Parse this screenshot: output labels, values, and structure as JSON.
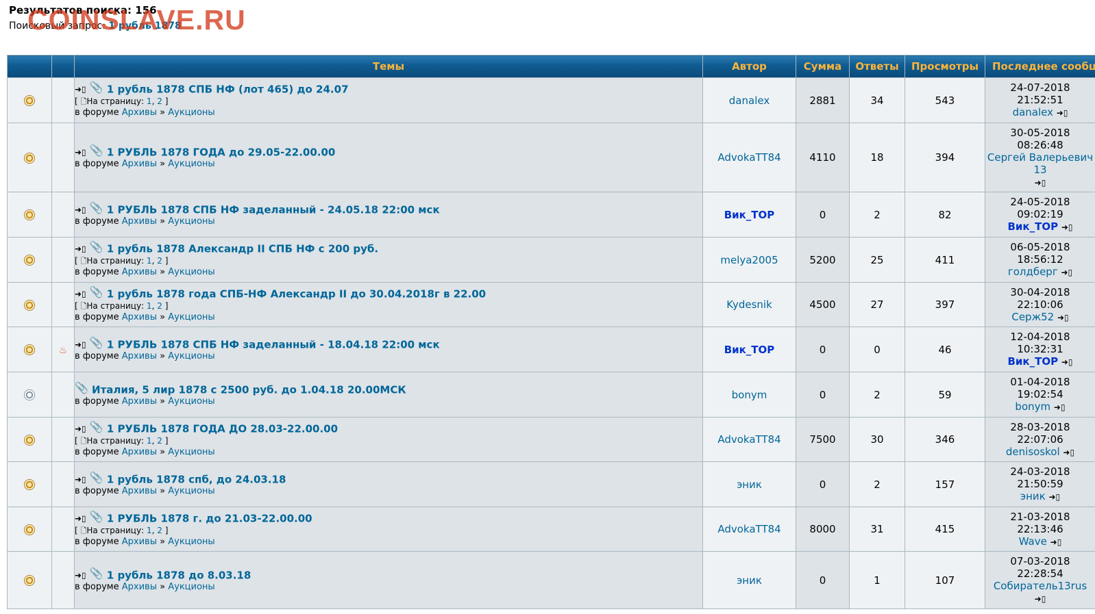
{
  "header": {
    "results_count": "Результатов поиска: 156",
    "query_label": "Поисковый запрос:",
    "query": "1 рубль 1878",
    "watermark": "COINSLAVE.RU"
  },
  "columns": {
    "topics": "Темы",
    "author": "Автор",
    "sum": "Сумма",
    "replies": "Ответы",
    "views": "Просмотры",
    "last_post": "Последнее сообщ"
  },
  "labels": {
    "forum_prefix": "в форуме",
    "sep": "»",
    "pages_open": "[",
    "pages_label": "На страницу:",
    "pages_close": "]",
    "page1": "1",
    "page2": "2",
    "comma": ",",
    "clip": "📎",
    "new_arrow": "➜▯",
    "last_arrow": "➜▯",
    "doc": "🗋",
    "hot": "♨"
  },
  "rows": [
    {
      "title": "1 рубль 1878 СПБ НФ (лот 465) до 24.07",
      "forum": "Архивы",
      "subforum": "Аукционы",
      "author": "danalex",
      "sum": "2881",
      "replies": "34",
      "views": "543",
      "last_date": "24-07-2018",
      "last_time": "21:52:51",
      "last_user": "danalex"
    },
    {
      "title": "1 РУБЛЬ 1878 ГОДА до 29.05-22.00.00",
      "forum": "Архивы",
      "subforum": "Аукционы",
      "author": "AdvokaTT84",
      "sum": "4110",
      "replies": "18",
      "views": "394",
      "last_date": "30-05-2018",
      "last_time": "08:26:48",
      "last_user": "Сергей Валерьевич 13"
    },
    {
      "title": "1 РУБЛЬ 1878 СПБ НФ заделанный - 24.05.18 22:00 мск",
      "forum": "Архивы",
      "subforum": "Аукционы",
      "author": "Вик_ТОР",
      "sum": "0",
      "replies": "2",
      "views": "82",
      "last_date": "24-05-2018",
      "last_time": "09:02:19",
      "last_user": "Вик_ТОР"
    },
    {
      "title": "1 рубль 1878 Александр II СПБ НФ с 200 руб.",
      "forum": "Архивы",
      "subforum": "Аукционы",
      "author": "melya2005",
      "sum": "5200",
      "replies": "25",
      "views": "411",
      "last_date": "06-05-2018",
      "last_time": "18:56:12",
      "last_user": "голдберг"
    },
    {
      "title": "1 рубль 1878 года СПБ-НФ Александр II до 30.04.2018г в 22.00",
      "forum": "Архивы",
      "subforum": "Аукционы",
      "author": "Kydesnik",
      "sum": "4500",
      "replies": "27",
      "views": "397",
      "last_date": "30-04-2018",
      "last_time": "22:10:06",
      "last_user": "Серж52"
    },
    {
      "title": "1 РУБЛЬ 1878 СПБ НФ заделанный - 18.04.18 22:00 мск",
      "forum": "Архивы",
      "subforum": "Аукционы",
      "author": "Вик_ТОР",
      "sum": "0",
      "replies": "0",
      "views": "46",
      "last_date": "12-04-2018",
      "last_time": "10:32:31",
      "last_user": "Вик_ТОР"
    },
    {
      "title": "Италия, 5 лир 1878 с 2500 руб. до 1.04.18 20.00МСК",
      "forum": "Архивы",
      "subforum": "Аукционы",
      "author": "bonym",
      "sum": "0",
      "replies": "2",
      "views": "59",
      "last_date": "01-04-2018",
      "last_time": "19:02:54",
      "last_user": "bonym"
    },
    {
      "title": "1 РУБЛЬ 1878 ГОДА ДО 28.03-22.00.00",
      "forum": "Архивы",
      "subforum": "Аукционы",
      "author": "AdvokaTT84",
      "sum": "7500",
      "replies": "30",
      "views": "346",
      "last_date": "28-03-2018",
      "last_time": "22:07:06",
      "last_user": "denisoskol"
    },
    {
      "title": "1 рубль 1878 спб, до 24.03.18",
      "forum": "Архивы",
      "subforum": "Аукционы",
      "author": "эник",
      "sum": "0",
      "replies": "2",
      "views": "157",
      "last_date": "24-03-2018",
      "last_time": "21:50:59",
      "last_user": "эник"
    },
    {
      "title": "1 РУБЛЬ 1878 г. до 21.03-22.00.00",
      "forum": "Архивы",
      "subforum": "Аукционы",
      "author": "AdvokaTT84",
      "sum": "8000",
      "replies": "31",
      "views": "415",
      "last_date": "21-03-2018",
      "last_time": "22:13:46",
      "last_user": "Wave"
    },
    {
      "title": "1 рубль 1878 до 8.03.18",
      "forum": "Архивы",
      "subforum": "Аукционы",
      "author": "эник",
      "sum": "0",
      "replies": "1",
      "views": "107",
      "last_date": "07-03-2018",
      "last_time": "22:28:54",
      "last_user": "Собиратель13rus"
    }
  ]
}
